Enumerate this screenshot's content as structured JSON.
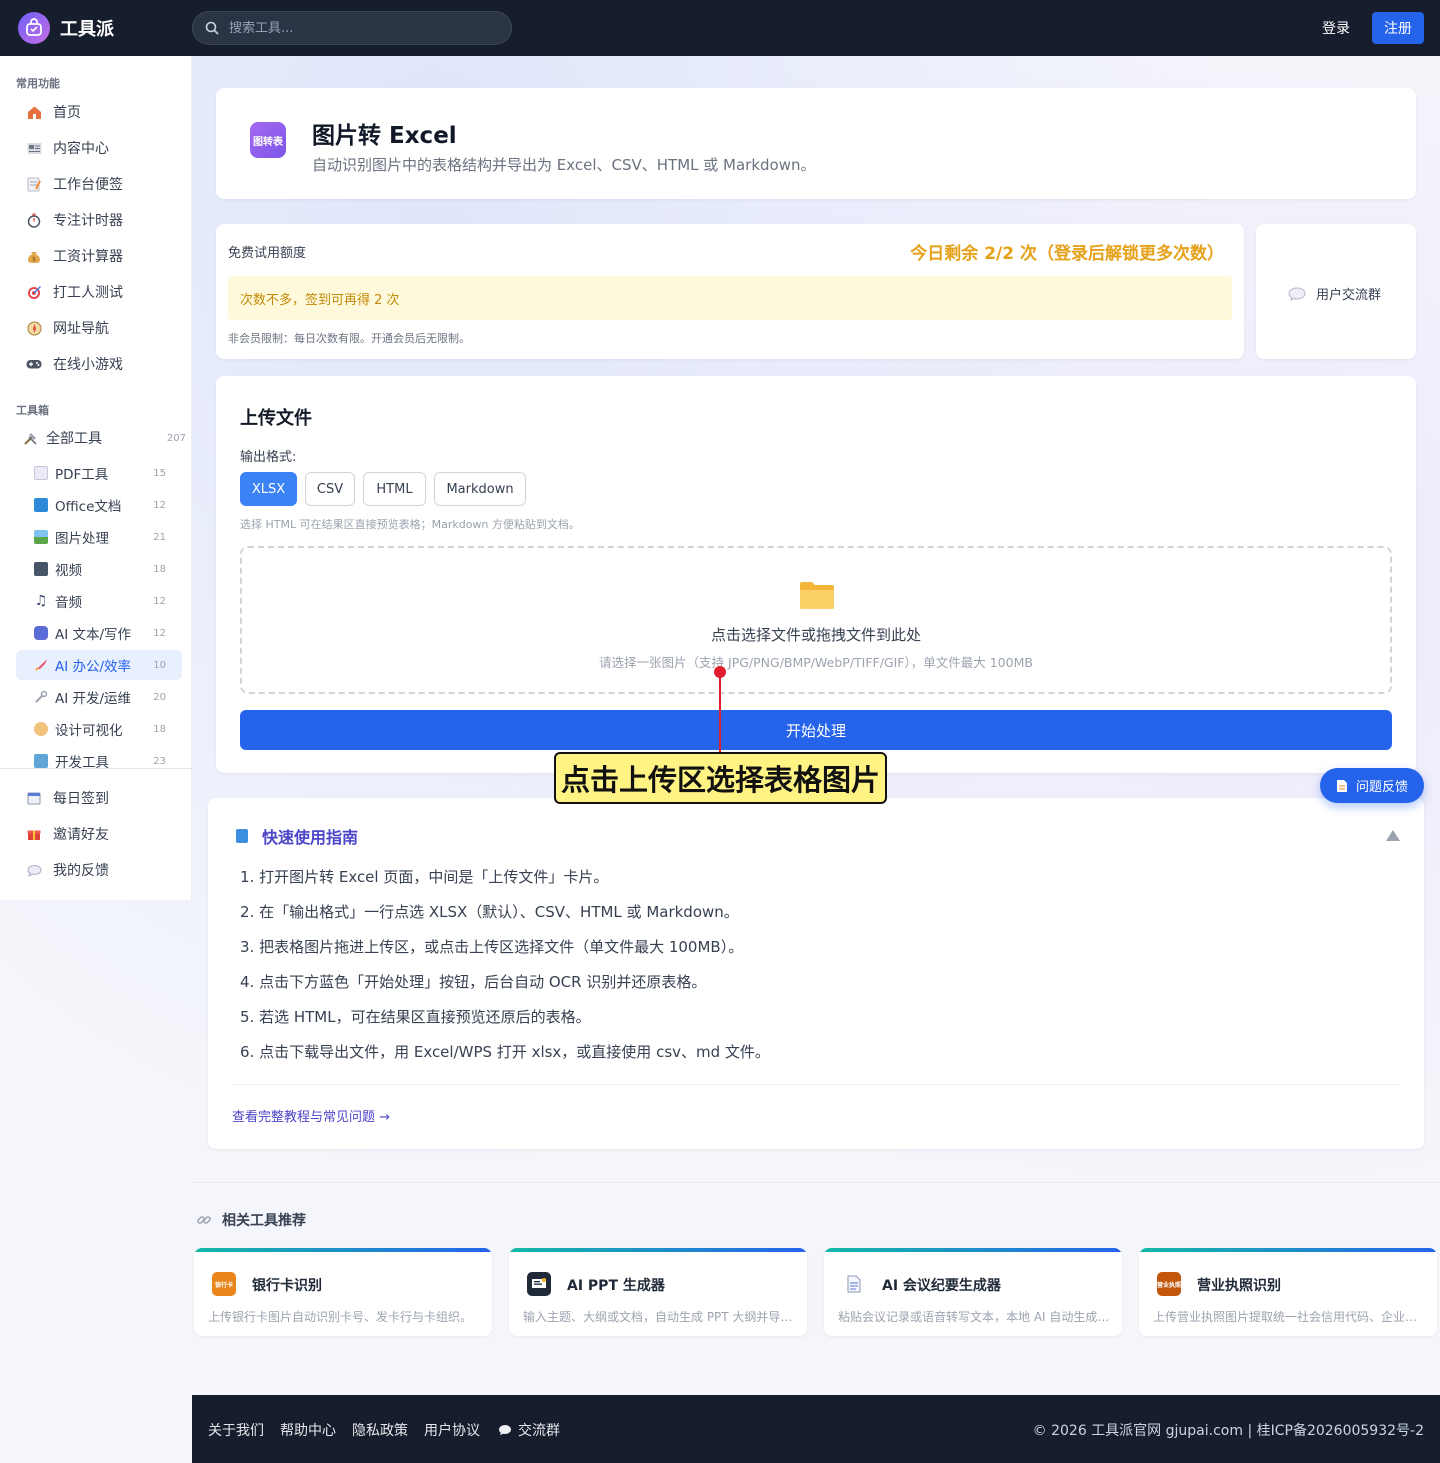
{
  "header": {
    "brand": "工具派",
    "search_placeholder": "搜索工具...",
    "login": "登录",
    "register": "注册"
  },
  "sidebar": {
    "common_title": "常用功能",
    "common_items": [
      {
        "label": "首页",
        "icon": "home-icon"
      },
      {
        "label": "内容中心",
        "icon": "news-icon"
      },
      {
        "label": "工作台便签",
        "icon": "memo-icon"
      },
      {
        "label": "专注计时器",
        "icon": "stopwatch-icon"
      },
      {
        "label": "工资计算器",
        "icon": "money-bag-icon"
      },
      {
        "label": "打工人测试",
        "icon": "target-icon"
      },
      {
        "label": "网址导航",
        "icon": "compass-icon"
      },
      {
        "label": "在线小游戏",
        "icon": "gamepad-icon"
      }
    ],
    "toolbox_title": "工具箱",
    "all_tools": {
      "label": "全部工具",
      "count": "207"
    },
    "categories": [
      {
        "label": "PDF工具",
        "count": "15"
      },
      {
        "label": "Office文档",
        "count": "12"
      },
      {
        "label": "图片处理",
        "count": "21"
      },
      {
        "label": "视频",
        "count": "18"
      },
      {
        "label": "音频",
        "count": "12"
      },
      {
        "label": "AI 文本/写作",
        "count": "12"
      },
      {
        "label": "AI 办公/效率",
        "count": "10"
      },
      {
        "label": "AI 开发/运维",
        "count": "20"
      },
      {
        "label": "设计可视化",
        "count": "18"
      },
      {
        "label": "开发工具",
        "count": "23"
      }
    ],
    "bottom_items": [
      {
        "label": "每日签到",
        "icon": "calendar-icon"
      },
      {
        "label": "邀请好友",
        "icon": "gift-icon"
      },
      {
        "label": "我的反馈",
        "icon": "speech-bubble-icon"
      }
    ]
  },
  "tool": {
    "icon_text": "图转表",
    "title": "图片转 Excel",
    "subtitle": "自动识别图片中的表格结构并导出为 Excel、CSV、HTML 或 Markdown。"
  },
  "quota": {
    "label": "免费试用额度",
    "remaining": "今日剩余 2/2 次（登录后解锁更多次数）",
    "warning": "次数不多，签到可再得 2 次",
    "note": "非会员限制：每日次数有限。开通会员后无限制。"
  },
  "group": {
    "label": "用户交流群"
  },
  "upload": {
    "title": "上传文件",
    "format_label": "输出格式:",
    "formats": [
      "XLSX",
      "CSV",
      "HTML",
      "Markdown"
    ],
    "selected_format": "XLSX",
    "hint": "选择 HTML 可在结果区直接预览表格；Markdown 方便粘贴到文档。",
    "drop_main": "点击选择文件或拖拽文件到此处",
    "drop_sub": "请选择一张图片（支持 JPG/PNG/BMP/WebP/TIFF/GIF），单文件最大 100MB",
    "start": "开始处理"
  },
  "annotation": {
    "text": "点击上传区选择表格图片"
  },
  "feedback": {
    "label": "问题反馈"
  },
  "guide": {
    "title": "快速使用指南",
    "steps": [
      "1. 打开图片转 Excel 页面，中间是「上传文件」卡片。",
      "2. 在「输出格式」一行点选 XLSX（默认）、CSV、HTML 或 Markdown。",
      "3. 把表格图片拖进上传区，或点击上传区选择文件（单文件最大 100MB）。",
      "4. 点击下方蓝色「开始处理」按钮，后台自动 OCR 识别并还原表格。",
      "5. 若选 HTML，可在结果区直接预览还原后的表格。",
      "6. 点击下载导出文件，用 Excel/WPS 打开 xlsx，或直接使用 csv、md 文件。"
    ],
    "link": "查看完整教程与常见问题 →"
  },
  "related": {
    "title": "相关工具推荐",
    "items": [
      {
        "name": "银行卡识别",
        "icon_text": "银行卡",
        "desc": "上传银行卡图片自动识别卡号、发卡行与卡组织。",
        "color": "#e8861d"
      },
      {
        "name": "AI PPT 生成器",
        "icon_text": "",
        "desc": "输入主题、大纲或文档，自动生成 PPT 大纲并导出演示文稿。",
        "color": "#1f2937"
      },
      {
        "name": "AI 会议纪要生成器",
        "icon_text": "",
        "desc": "粘贴会议记录或语音转写文本，本地 AI 自动生成会议纪要。",
        "color": "#ffffff"
      },
      {
        "name": "营业执照识别",
        "icon_text": "营业执照",
        "desc": "上传营业执照图片提取统一社会信用代码、企业名称等信息。",
        "color": "#c2570c"
      }
    ]
  },
  "footer": {
    "links": [
      "关于我们",
      "帮助中心",
      "隐私政策",
      "用户协议",
      "交流群"
    ],
    "copyright": "© 2026 工具派官网 gjupai.com | 桂ICP备2026005932号-2"
  }
}
